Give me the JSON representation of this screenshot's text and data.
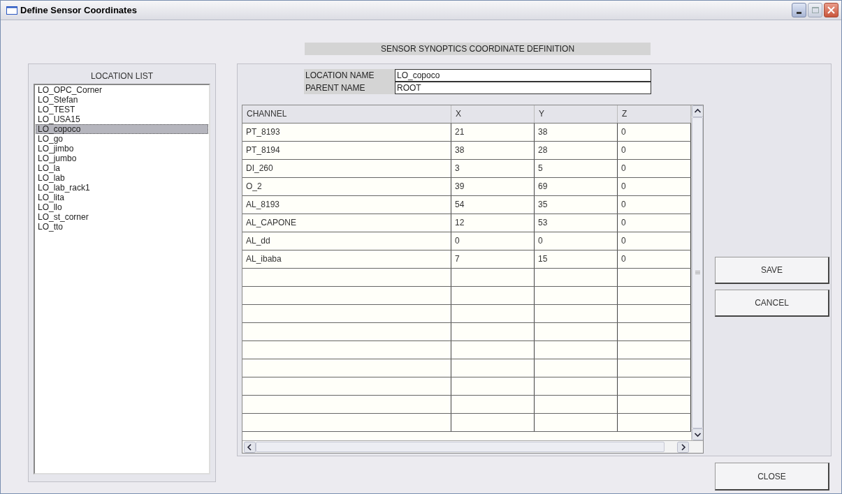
{
  "window": {
    "title": "Define Sensor Coordinates"
  },
  "heading": "SENSOR SYNOPTICS COORDINATE DEFINITION",
  "location_list": {
    "title": "LOCATION LIST",
    "items": [
      {
        "label": "LO_OPC_Corner",
        "selected": false
      },
      {
        "label": "LO_Stefan",
        "selected": false
      },
      {
        "label": "LO_TEST",
        "selected": false
      },
      {
        "label": "LO_USA15",
        "selected": false
      },
      {
        "label": "LO_copoco",
        "selected": true
      },
      {
        "label": "LO_go",
        "selected": false
      },
      {
        "label": "LO_jimbo",
        "selected": false
      },
      {
        "label": "LO_jumbo",
        "selected": false
      },
      {
        "label": "LO_la",
        "selected": false
      },
      {
        "label": "LO_lab",
        "selected": false
      },
      {
        "label": "LO_lab_rack1",
        "selected": false
      },
      {
        "label": "LO_lita",
        "selected": false
      },
      {
        "label": "LO_llo",
        "selected": false
      },
      {
        "label": "LO_st_corner",
        "selected": false
      },
      {
        "label": "LO_tto",
        "selected": false
      }
    ]
  },
  "fields": [
    {
      "label": "LOCATION NAME",
      "value": "LO_copoco"
    },
    {
      "label": "PARENT NAME",
      "value": "ROOT"
    }
  ],
  "table": {
    "columns": [
      "CHANNEL",
      "X",
      "Y",
      "Z"
    ],
    "rows": [
      [
        "PT_8193",
        "21",
        "38",
        "0"
      ],
      [
        "PT_8194",
        "38",
        "28",
        "0"
      ],
      [
        "DI_260",
        "3",
        "5",
        "0"
      ],
      [
        "O_2",
        "39",
        "69",
        "0"
      ],
      [
        "AL_8193",
        "54",
        "35",
        "0"
      ],
      [
        "AL_CAPONE",
        "12",
        "53",
        "0"
      ],
      [
        "AL_dd",
        "0",
        "0",
        "0"
      ],
      [
        "AL_ibaba",
        "7",
        "15",
        "0"
      ]
    ]
  },
  "buttons": [
    "SAVE",
    "CANCEL"
  ],
  "close_button": "CLOSE"
}
